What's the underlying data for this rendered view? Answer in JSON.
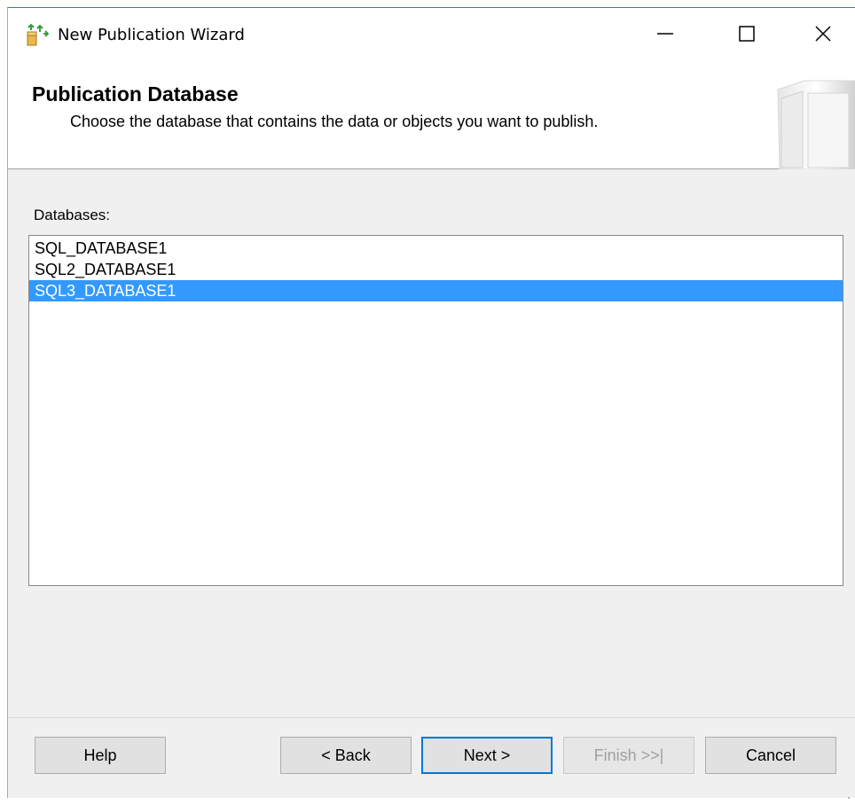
{
  "window": {
    "title": "New Publication Wizard",
    "controls": {
      "minimize": "minimize",
      "maximize": "maximize",
      "close": "close"
    }
  },
  "header": {
    "title": "Publication Database",
    "subtitle": "Choose the database that contains the data or objects you want to publish."
  },
  "databases": {
    "label": "Databases:",
    "items": [
      {
        "name": "SQL_DATABASE1",
        "selected": false
      },
      {
        "name": "SQL2_DATABASE1",
        "selected": false
      },
      {
        "name": "SQL3_DATABASE1",
        "selected": true
      }
    ]
  },
  "buttons": {
    "help": "Help",
    "back": "< Back",
    "next": "Next >",
    "finish": "Finish >>|",
    "cancel": "Cancel"
  },
  "colors": {
    "selection": "#3399ff",
    "titlebar_border": "#1883d7",
    "default_button_border": "#0078d7"
  },
  "icons": {
    "app": "publication-wizard-icon",
    "minimize": "minimize-icon",
    "maximize": "maximize-icon",
    "close": "close-icon",
    "header": "header-graphic"
  }
}
